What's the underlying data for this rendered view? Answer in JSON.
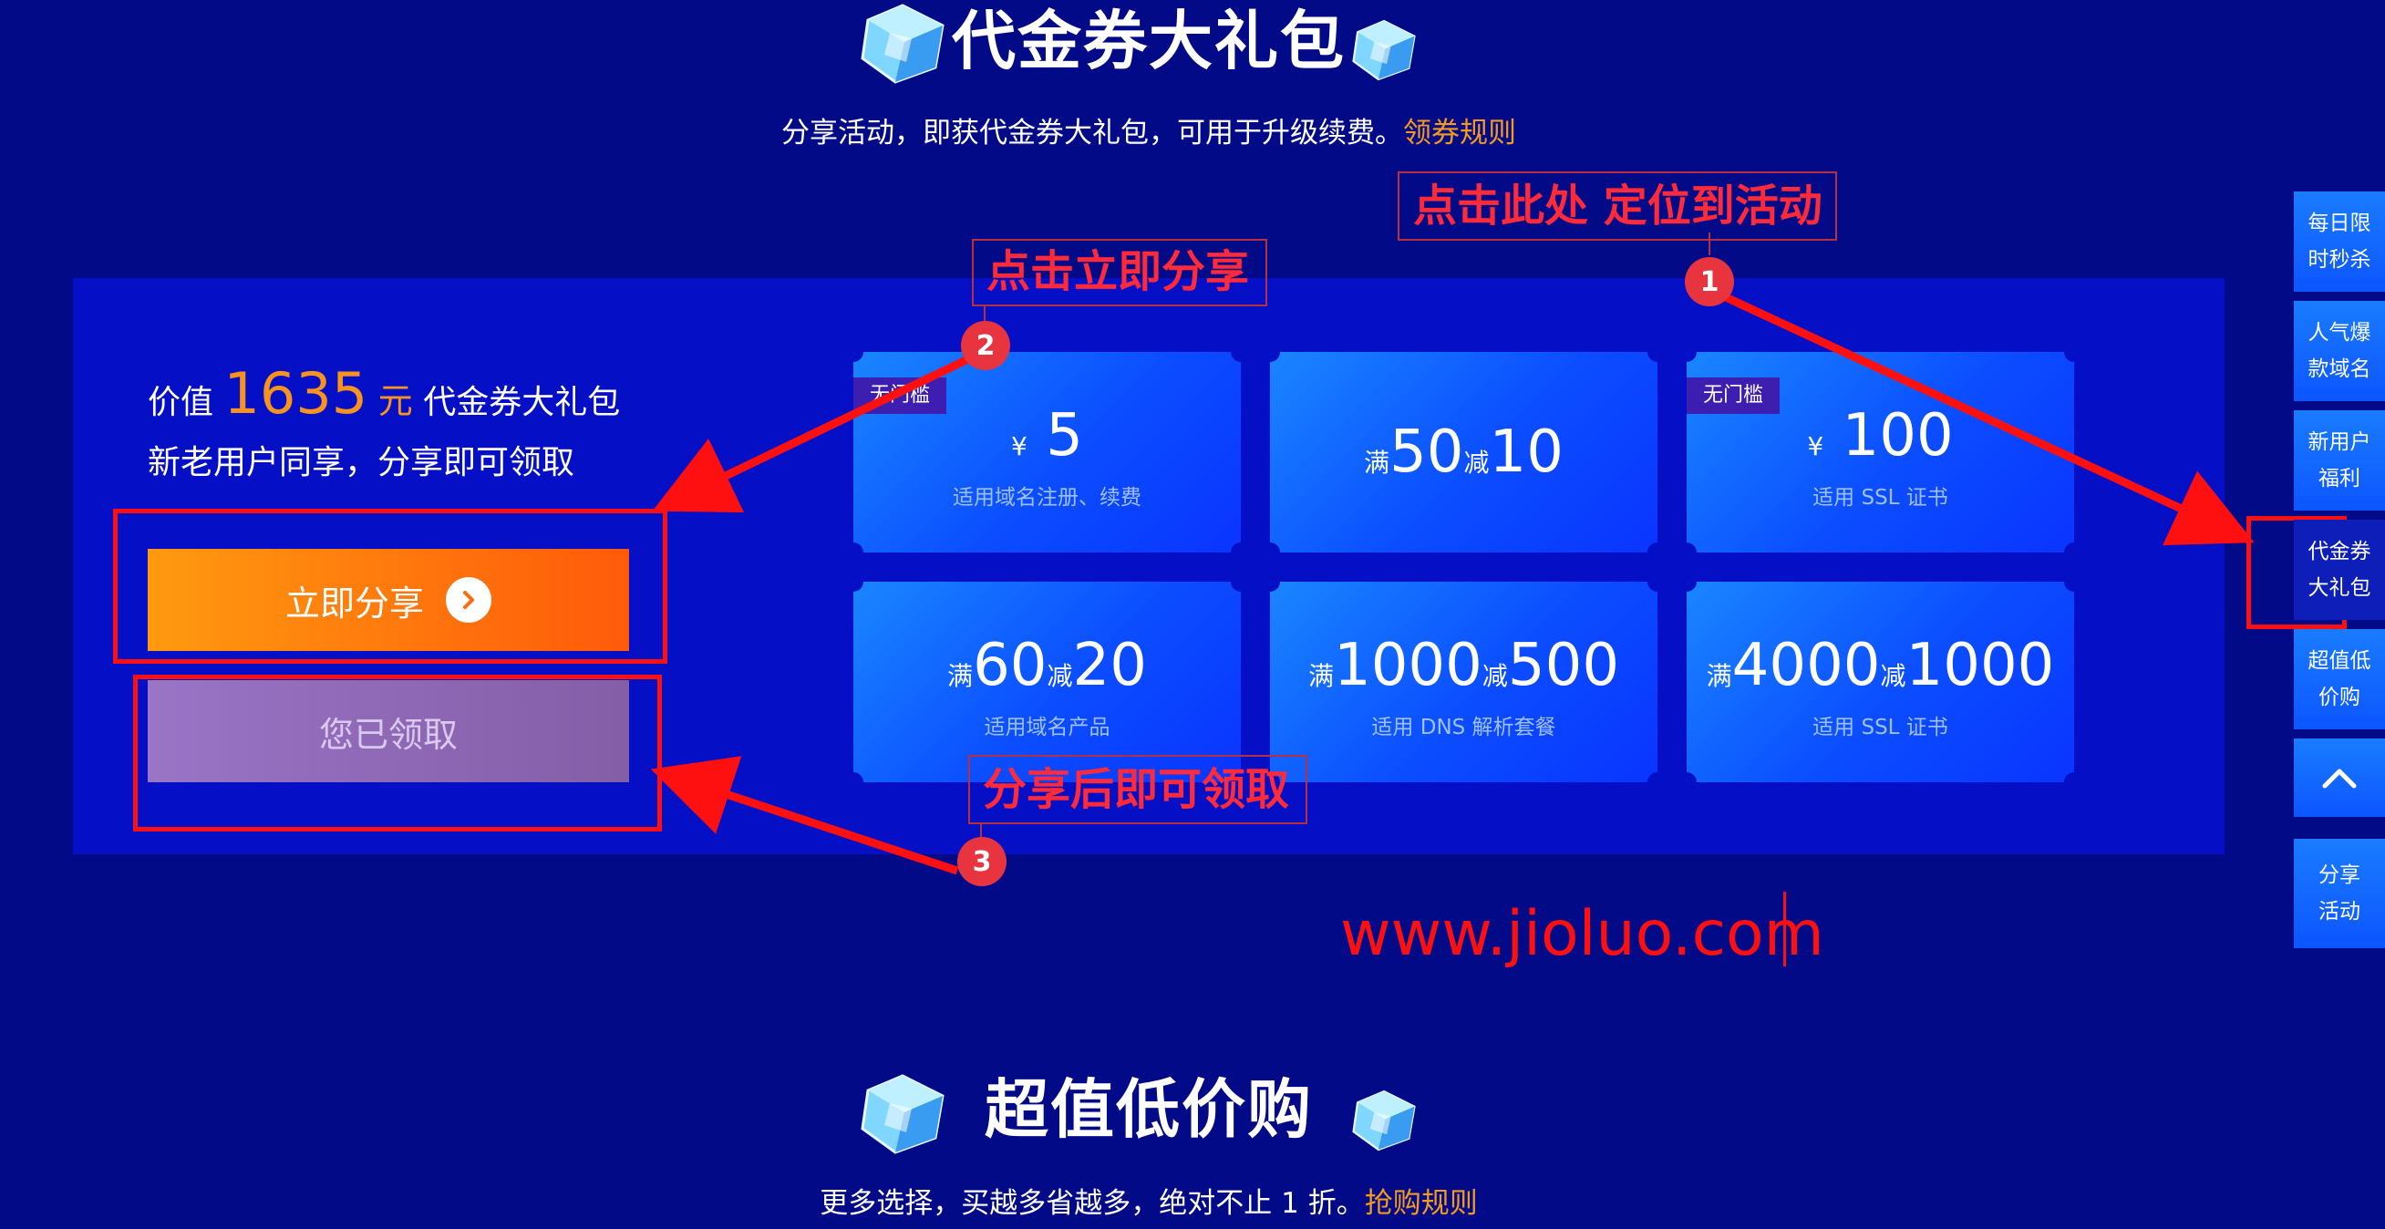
{
  "section_top": {
    "title": "代金券大礼包",
    "subtitle": "分享活动，即获代金券大礼包，可用于升级续费。",
    "rule_link": "领券规则"
  },
  "panel": {
    "value_prefix": "价值",
    "value_amount": "1635",
    "value_unit": "元",
    "value_suffix": "代金券大礼包",
    "subtitle": "新老用户同享，分享即可领取",
    "share_button": "立即分享",
    "claimed_button": "您已领取"
  },
  "coupons": [
    {
      "tag": "无门槛",
      "currency": "¥",
      "amount": "5",
      "desc": "适用域名注册、续费"
    },
    {
      "pre1": "满",
      "num1": "50",
      "pre2": "减",
      "num2": "10",
      "desc": ""
    },
    {
      "tag": "无门槛",
      "currency": "¥",
      "amount": "100",
      "desc": "适用 SSL 证书"
    },
    {
      "pre1": "满",
      "num1": "60",
      "pre2": "减",
      "num2": "20",
      "desc": "适用域名产品"
    },
    {
      "pre1": "满",
      "num1": "1000",
      "pre2": "减",
      "num2": "500",
      "desc": "适用 DNS 解析套餐"
    },
    {
      "pre1": "满",
      "num1": "4000",
      "pre2": "减",
      "num2": "1000",
      "desc": "适用 SSL 证书"
    }
  ],
  "annotations": {
    "a1": "点击此处 定位到活动",
    "a2": "点击立即分享",
    "a3": "分享后即可领取",
    "n1": "1",
    "n2": "2",
    "n3": "3",
    "watermark": "www.jioluo.com"
  },
  "side_nav": [
    {
      "line1": "每日限",
      "line2": "时秒杀"
    },
    {
      "line1": "人气爆",
      "line2": "款域名"
    },
    {
      "line1": "新用户",
      "line2": "福利"
    },
    {
      "line1": "代金券",
      "line2": "大礼包"
    },
    {
      "line1": "超值低",
      "line2": "价购"
    },
    {
      "line1": "分享",
      "line2": "活动"
    }
  ],
  "section_bottom": {
    "title": "超值低价购",
    "subtitle": "更多选择，买越多省越多，绝对不止 1 折。",
    "rule_link": "抢购规则"
  },
  "colors": {
    "background": "#020a88",
    "panel": "#0510c6",
    "accent_orange": "#f7931e",
    "annotation_red": "#ff1010"
  }
}
